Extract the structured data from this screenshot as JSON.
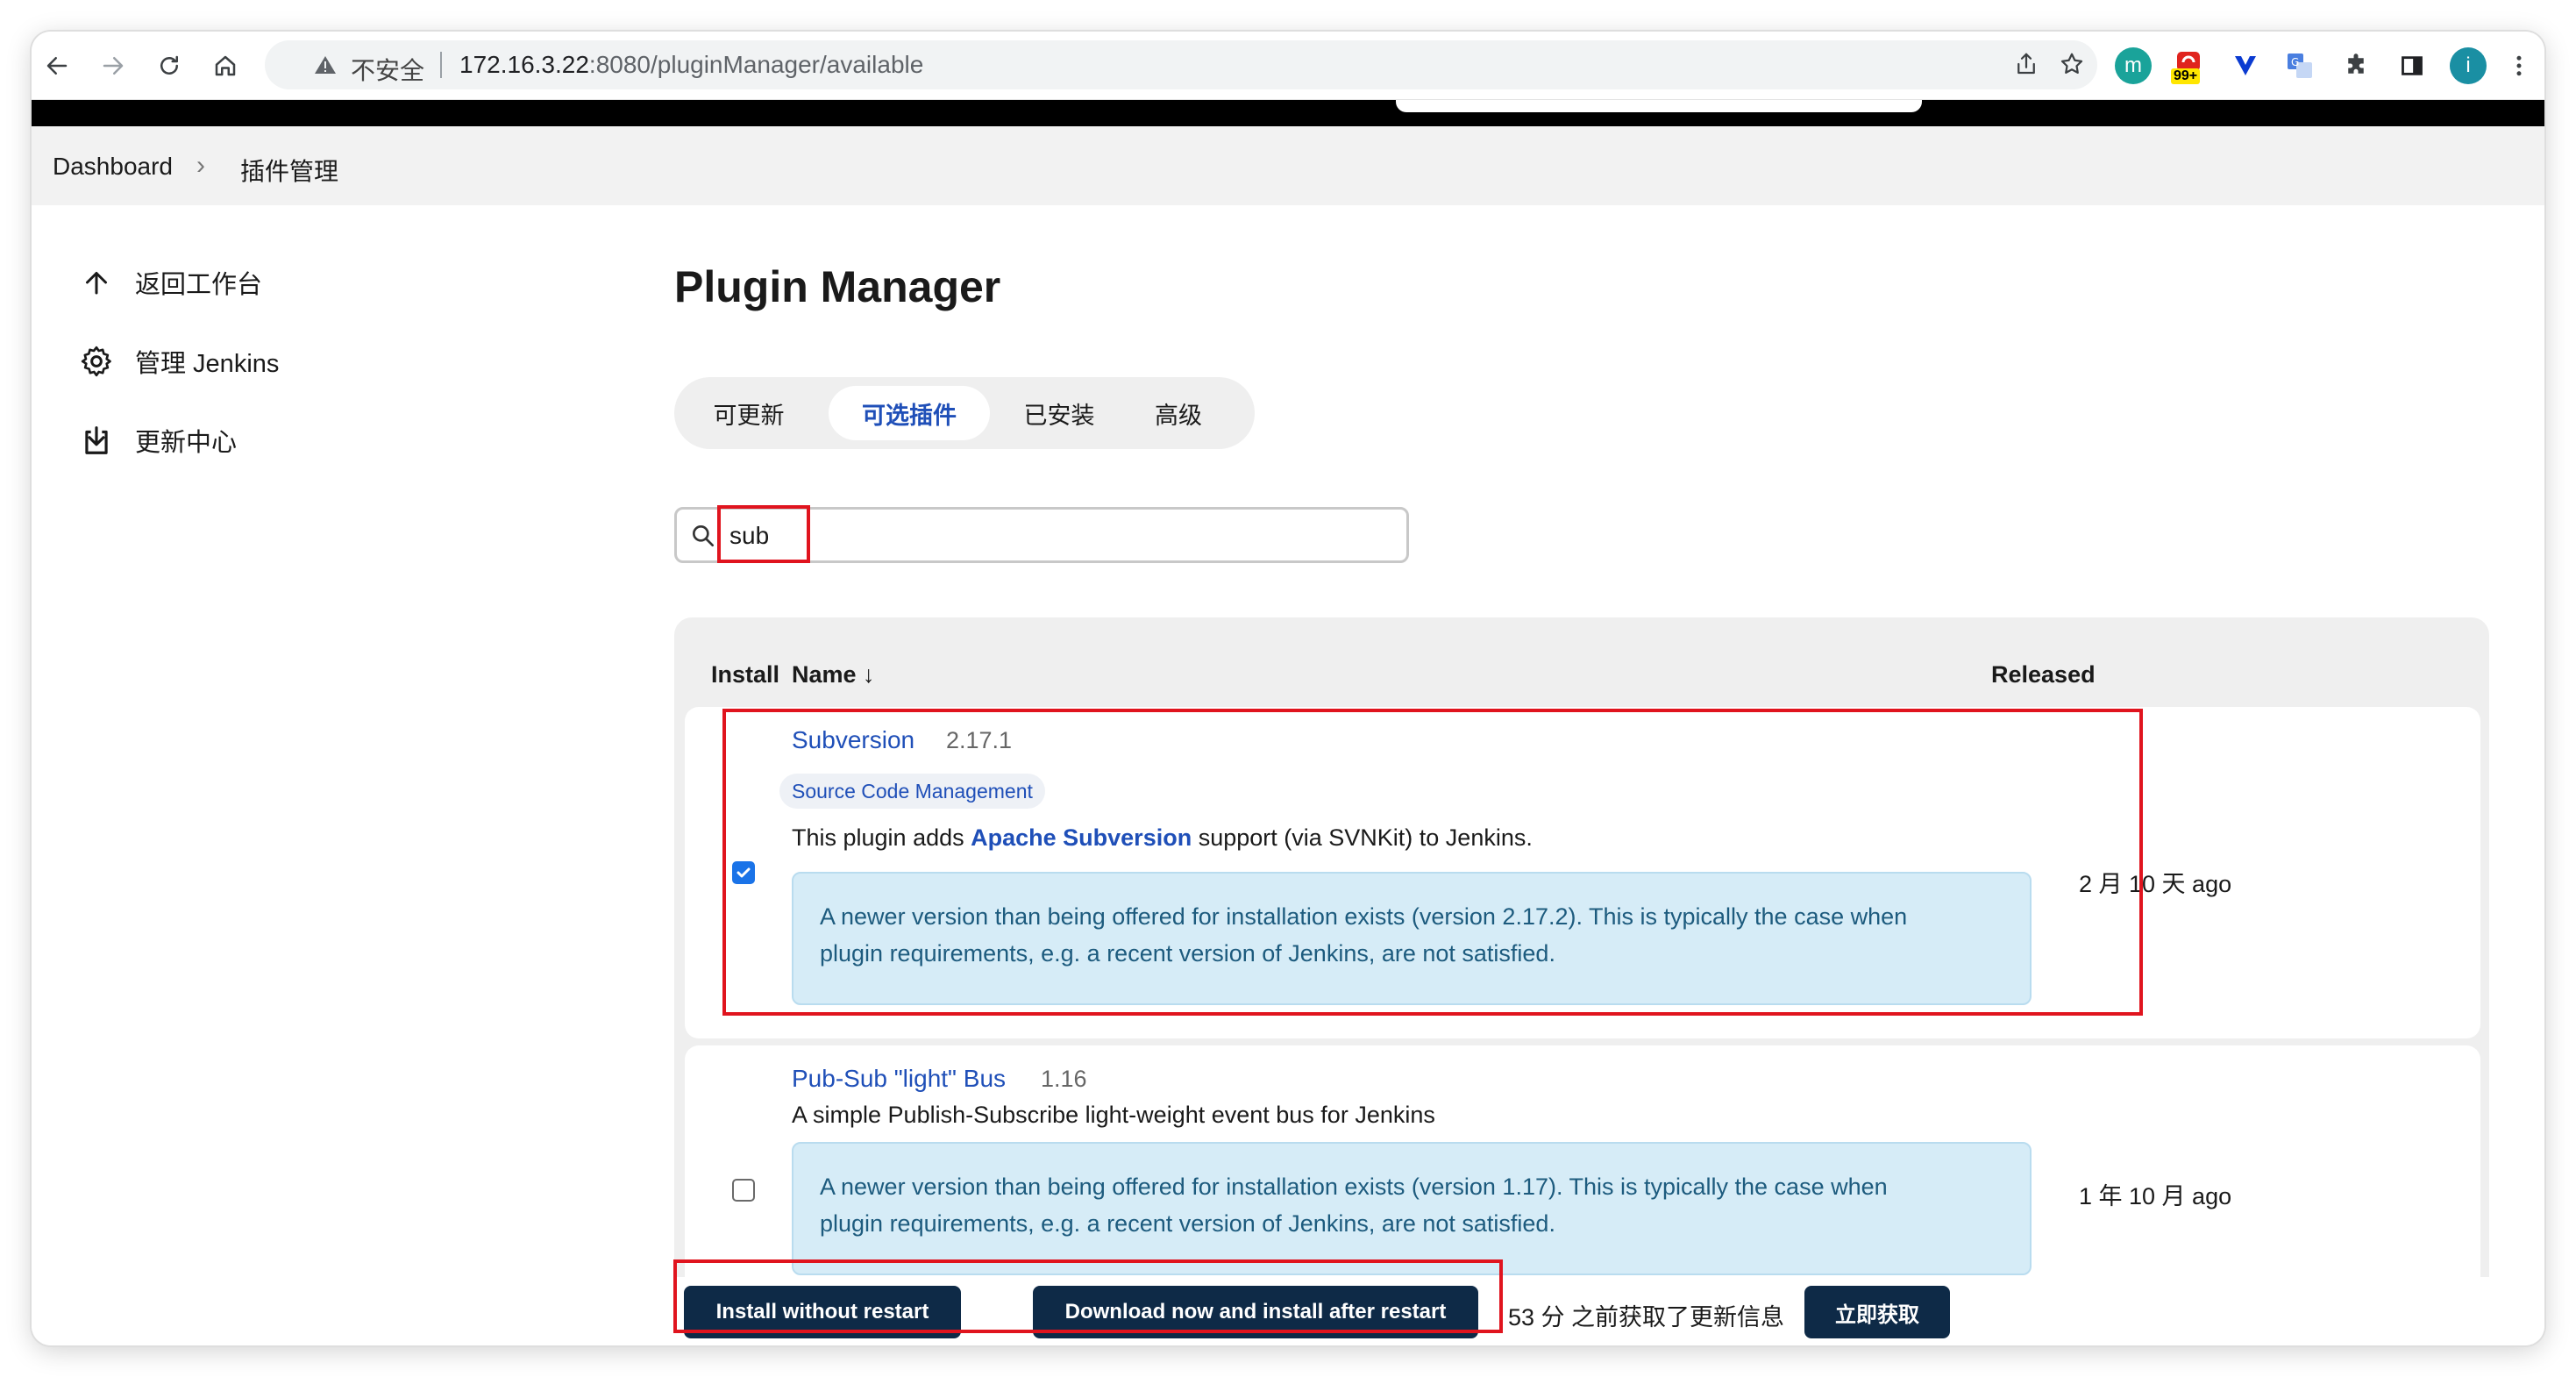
{
  "browser": {
    "insecure_label": "不安全",
    "url_host": "172.16.3.22",
    "url_rest": ":8080/pluginManager/available",
    "ext_badge": "99+"
  },
  "breadcrumb": {
    "items": [
      "Dashboard",
      "插件管理"
    ]
  },
  "sidebar": {
    "items": [
      {
        "label": "返回工作台",
        "icon": "arrow-up-icon"
      },
      {
        "label": "管理 Jenkins",
        "icon": "gear-icon"
      },
      {
        "label": "更新中心",
        "icon": "download-icon"
      }
    ]
  },
  "main": {
    "title": "Plugin Manager",
    "tabs": [
      {
        "label": "可更新"
      },
      {
        "label": "可选插件",
        "active": true
      },
      {
        "label": "已安装"
      },
      {
        "label": "高级"
      }
    ],
    "search": {
      "value": "sub"
    }
  },
  "table": {
    "headers": {
      "install": "Install",
      "name": "Name ↓",
      "released": "Released"
    },
    "rows": [
      {
        "name": "Subversion",
        "version": "2.17.1",
        "tag": "Source Code Management",
        "desc_pre": "This plugin adds ",
        "desc_link": "Apache Subversion",
        "desc_post": " support (via SVNKit) to Jenkins.",
        "notice_line1": "A newer version than being offered for installation exists (version 2.17.2). This is typically the case when",
        "notice_line2": "plugin requirements, e.g. a recent version of Jenkins, are not satisfied.",
        "released": "2 月 10 天 ago",
        "checked": true
      },
      {
        "name": "Pub-Sub \"light\" Bus",
        "version": "1.16",
        "desc": "A simple Publish-Subscribe light-weight event bus for Jenkins",
        "notice_line1": "A newer version than being offered for installation exists (version 1.17). This is typically the case when",
        "notice_line2": "plugin requirements, e.g. a recent version of Jenkins, are not satisfied.",
        "released": "1 年 10 月 ago",
        "checked": false
      }
    ]
  },
  "bottom": {
    "install_without_restart": "Install without restart",
    "download_after_restart": "Download now and install after restart",
    "status": "53 分 之前获取了更新信息",
    "fetch_now": "立即获取"
  },
  "colors": {
    "accent": "#1f4fb8",
    "dark_button": "#0e2a47",
    "highlight": "#e0141e",
    "notice_bg": "#d6ecf7"
  }
}
